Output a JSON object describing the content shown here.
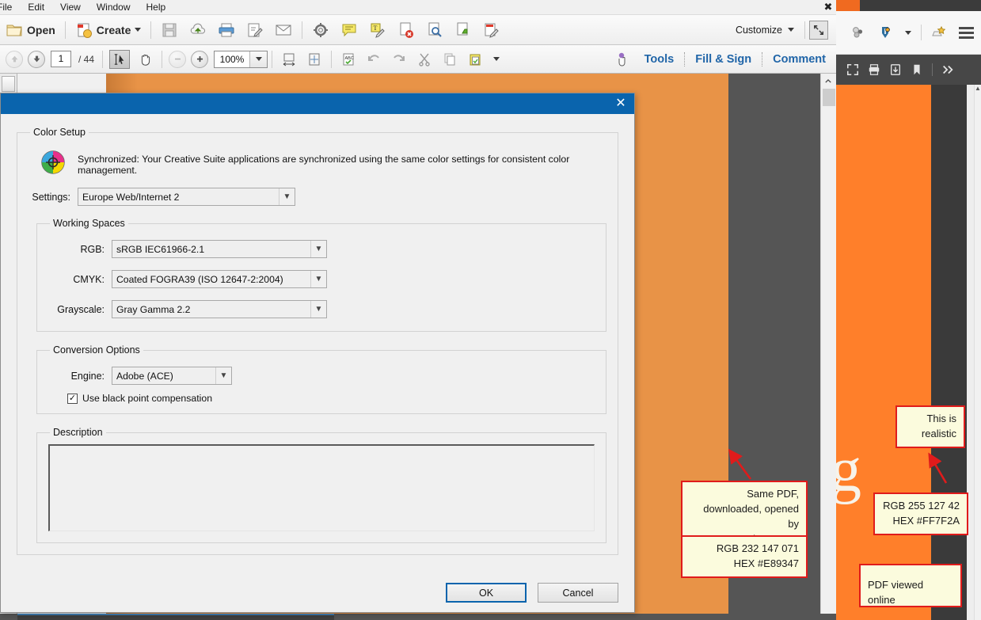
{
  "acrobat": {
    "menubar": [
      "File",
      "Edit",
      "View",
      "Window",
      "Help"
    ],
    "toolbar1": {
      "open_label": "Open",
      "create_label": "Create",
      "customize_label": "Customize",
      "icons": [
        "folder-open-icon",
        "create-pdf-icon",
        "save-icon",
        "upload-cloud-icon",
        "print-icon",
        "sign-icon",
        "email-icon",
        "gear-icon",
        "comment-bubble-icon",
        "text-highlight-icon",
        "delete-page-icon",
        "search-page-icon",
        "export-page-icon",
        "edit-page-icon"
      ]
    },
    "toolbar2": {
      "page_current": "1",
      "page_total": "/ 44",
      "zoom_value": "100%",
      "tools_label": "Tools",
      "fillsign_label": "Fill & Sign",
      "comment_label": "Comment"
    },
    "window_close": "✖"
  },
  "dialog": {
    "close_label": "✕",
    "color_setup": {
      "legend": "Color Setup",
      "sync_text": "Synchronized: Your Creative Suite applications are synchronized using the same color settings for consistent color management.",
      "settings_label": "Settings:",
      "settings_value": "Europe Web/Internet 2"
    },
    "working_spaces": {
      "legend": "Working Spaces",
      "rows": [
        {
          "label": "RGB:",
          "value": "sRGB IEC61966-2.1"
        },
        {
          "label": "CMYK:",
          "value": "Coated FOGRA39 (ISO 12647-2:2004)"
        },
        {
          "label": "Grayscale:",
          "value": "Gray Gamma 2.2"
        }
      ]
    },
    "conversion_options": {
      "legend": "Conversion Options",
      "engine_label": "Engine:",
      "engine_value": "Adobe (ACE)",
      "bpc_label": "Use black point compensation",
      "bpc_checked": "✓"
    },
    "description": {
      "legend": "Description",
      "value": ""
    },
    "buttons": {
      "ok": "OK",
      "cancel": "Cancel"
    }
  },
  "browser": {
    "toolbar_icons": [
      "pocket-icon",
      "download-arrow-icon",
      "chevron-down-icon",
      "bookmark-star-icon",
      "hamburger-menu-icon"
    ],
    "pdf_toolbar_icons": [
      "fullscreen-icon",
      "print-icon",
      "download-icon",
      "bookmark-icon",
      "chevrons-right-icon"
    ],
    "page_glyph": "g"
  },
  "annotations": {
    "note_same_pdf": "Same PDF,\ndownloaded, opened by\nAcrobat XI Pro",
    "note_rgb_acrobat": "RGB 232 147 071\nHEX  #E89347",
    "note_realistic": "This is\nrealistic",
    "note_rgb_online": "RGB 255 127 42\nHEX  #FF7F2A",
    "note_viewed_online": "PDF viewed online"
  },
  "colors": {
    "acrobat_orange": "#E89347",
    "online_orange": "#FF7F2A",
    "dialog_title": "#0A64AD",
    "note_bg": "#FBFBDD",
    "note_border": "#E01B1B",
    "accent_blue": "#2065A8"
  }
}
